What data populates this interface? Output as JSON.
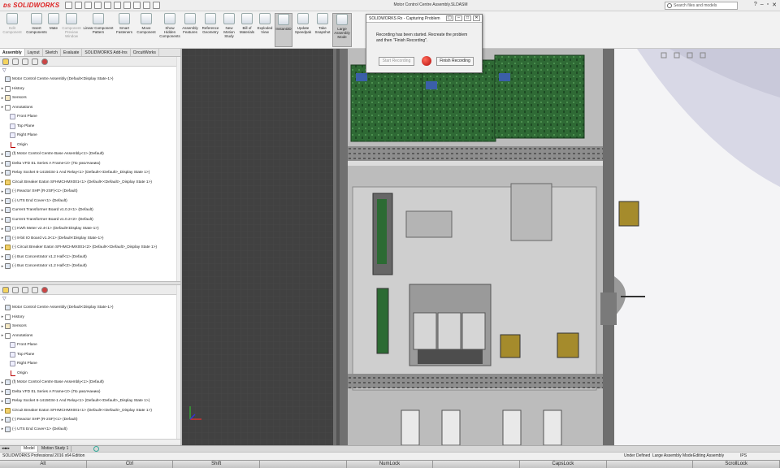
{
  "app": {
    "logo_text": "SOLIDWORKS",
    "window_title": "Motor Control Centre Assembly.SLDASM",
    "search_placeholder": "Search files and models"
  },
  "ribbon": {
    "buttons": [
      {
        "label": "Edit Component",
        "enabled": false,
        "icon": "edit-component-icon"
      },
      {
        "label": "Insert Components",
        "enabled": true,
        "icon": "insert-components-icon"
      },
      {
        "label": "Mate",
        "enabled": true,
        "icon": "mate-icon"
      },
      {
        "label": "Component Preview Window",
        "enabled": false,
        "icon": "preview-window-icon"
      },
      {
        "label": "Linear Component Pattern",
        "enabled": true,
        "icon": "linear-pattern-icon"
      },
      {
        "label": "Smart Fasteners",
        "enabled": true,
        "icon": "smart-fasteners-icon"
      },
      {
        "label": "Move Component",
        "enabled": true,
        "icon": "move-component-icon"
      },
      {
        "label": "Show Hidden Components",
        "enabled": true,
        "icon": "show-hidden-icon"
      },
      {
        "label": "Assembly Features",
        "enabled": true,
        "icon": "assembly-features-icon"
      },
      {
        "label": "Reference Geometry",
        "enabled": true,
        "icon": "reference-geometry-icon"
      },
      {
        "label": "New Motion Study",
        "enabled": true,
        "icon": "motion-study-icon"
      },
      {
        "label": "Bill of Materials",
        "enabled": true,
        "icon": "bom-icon"
      },
      {
        "label": "Exploded View",
        "enabled": true,
        "icon": "exploded-view-icon"
      },
      {
        "label": "Instant3D",
        "enabled": true,
        "active": true,
        "icon": "instant3d-icon"
      },
      {
        "label": "Update Speedpak",
        "enabled": true,
        "icon": "speedpak-icon"
      },
      {
        "label": "Take Snapshot",
        "enabled": true,
        "icon": "snapshot-icon"
      },
      {
        "label": "Large Assembly Mode",
        "enabled": true,
        "active": true,
        "icon": "large-assembly-icon"
      }
    ]
  },
  "command_tabs": [
    "Assembly",
    "Layout",
    "Sketch",
    "Evaluate",
    "SOLIDWORKS Add-Ins",
    "CircuitWorks"
  ],
  "tree": {
    "root": "Motor Control Centre Assembly  (Default<Display State-1>)",
    "items": [
      {
        "label": "History",
        "icon": "folder"
      },
      {
        "label": "Sensors",
        "icon": "sensor"
      },
      {
        "label": "Annotations",
        "icon": "annotation"
      },
      {
        "label": "Front Plane",
        "icon": "plane"
      },
      {
        "label": "Top Plane",
        "icon": "plane"
      },
      {
        "label": "Right Plane",
        "icon": "plane"
      },
      {
        "label": "Origin",
        "icon": "origin"
      },
      {
        "label": "(f) Motor Control Centre Base Assembly<1> (Default)",
        "icon": "assembly"
      },
      {
        "label": "Delta VFD EL Series A Frame<2> (По умолчанию)",
        "icon": "assembly"
      },
      {
        "label": "Relay Socket 6-1415034-1 And Relay<1> (Default<<Default>_Display State 1>)",
        "icon": "assembly"
      },
      {
        "label": "Circuit Breaker Eaton SFHMCHMX001<1> (Default<<Default>_Display State 1>)",
        "icon": "part-yellow"
      },
      {
        "label": "(-) Reactor SHP (R-2SF)<1> (Default)",
        "icon": "assembly"
      },
      {
        "label": "(-) UTS End Cover<1> (Default)",
        "icon": "assembly"
      },
      {
        "label": "Current Transformer Board v1.0.2<1> (Default)",
        "icon": "assembly"
      },
      {
        "label": "Current Transformer Board v1.0.2<2> (Default)",
        "icon": "assembly"
      },
      {
        "label": "(-) KWh Meter v2.4<1> (Default<Display State-1>)",
        "icon": "assembly"
      },
      {
        "label": "(-) 8-bit IO Board v1.3<1> (Default<Display State-1>)",
        "icon": "assembly"
      },
      {
        "label": "(-) Circuit Breaker Eaton SFHMCHMX001<2> (Default<<Default>_Display State 1>)",
        "icon": "part-yellow"
      },
      {
        "label": "(-) Bus Concentrator v1.2 Half<1> (Default)",
        "icon": "assembly"
      },
      {
        "label": "(-) Bus Concentrator v1.2 Half<2> (Default)",
        "icon": "assembly"
      }
    ]
  },
  "tree2": {
    "root": "Motor Control Centre Assembly  (Default<Display State-1>)",
    "items": [
      {
        "label": "History",
        "icon": "folder"
      },
      {
        "label": "Sensors",
        "icon": "sensor"
      },
      {
        "label": "Annotations",
        "icon": "annotation"
      },
      {
        "label": "Front Plane",
        "icon": "plane"
      },
      {
        "label": "Top Plane",
        "icon": "plane"
      },
      {
        "label": "Right Plane",
        "icon": "plane"
      },
      {
        "label": "Origin",
        "icon": "origin"
      },
      {
        "label": "(f) Motor Control Centre Base Assembly<1> (Default)",
        "icon": "assembly"
      },
      {
        "label": "Delta VFD EL Series A Frame<2> (По умолчанию)",
        "icon": "assembly"
      },
      {
        "label": "Relay Socket 6-1415034-1 And Relay<1> (Default<<Default>_Display State 1>)",
        "icon": "assembly"
      },
      {
        "label": "Circuit Breaker Eaton SFHMCHMX001<1> (Default<<Default>_Display State 1>)",
        "icon": "part-yellow"
      },
      {
        "label": "(-) Reactor SHP (R-2SF)<1> (Default)",
        "icon": "assembly"
      },
      {
        "label": "(-) UTS End Cover<1> (Default)",
        "icon": "assembly"
      }
    ]
  },
  "record_dialog": {
    "title": "SOLIDWORKS Rx - Capturing Problem",
    "message": "Recording has been started. Recreate the problem and then \"Finish Recording\".",
    "start_label": "Start Recording",
    "finish_label": "Finish Recording"
  },
  "bottom_tabs": [
    "Model",
    "Motion Study 1"
  ],
  "status": {
    "edition": "SOLIDWORKS Professional 2016 x64 Edition",
    "state": "Under Defined",
    "mode": "Large Assembly Mode",
    "editing": "Editing Assembly",
    "units": "IPS"
  },
  "keyboard": [
    "Alt",
    "Ctrl",
    "Shift",
    "",
    "NumLock",
    "",
    "CapsLock",
    "",
    "ScrollLock"
  ]
}
